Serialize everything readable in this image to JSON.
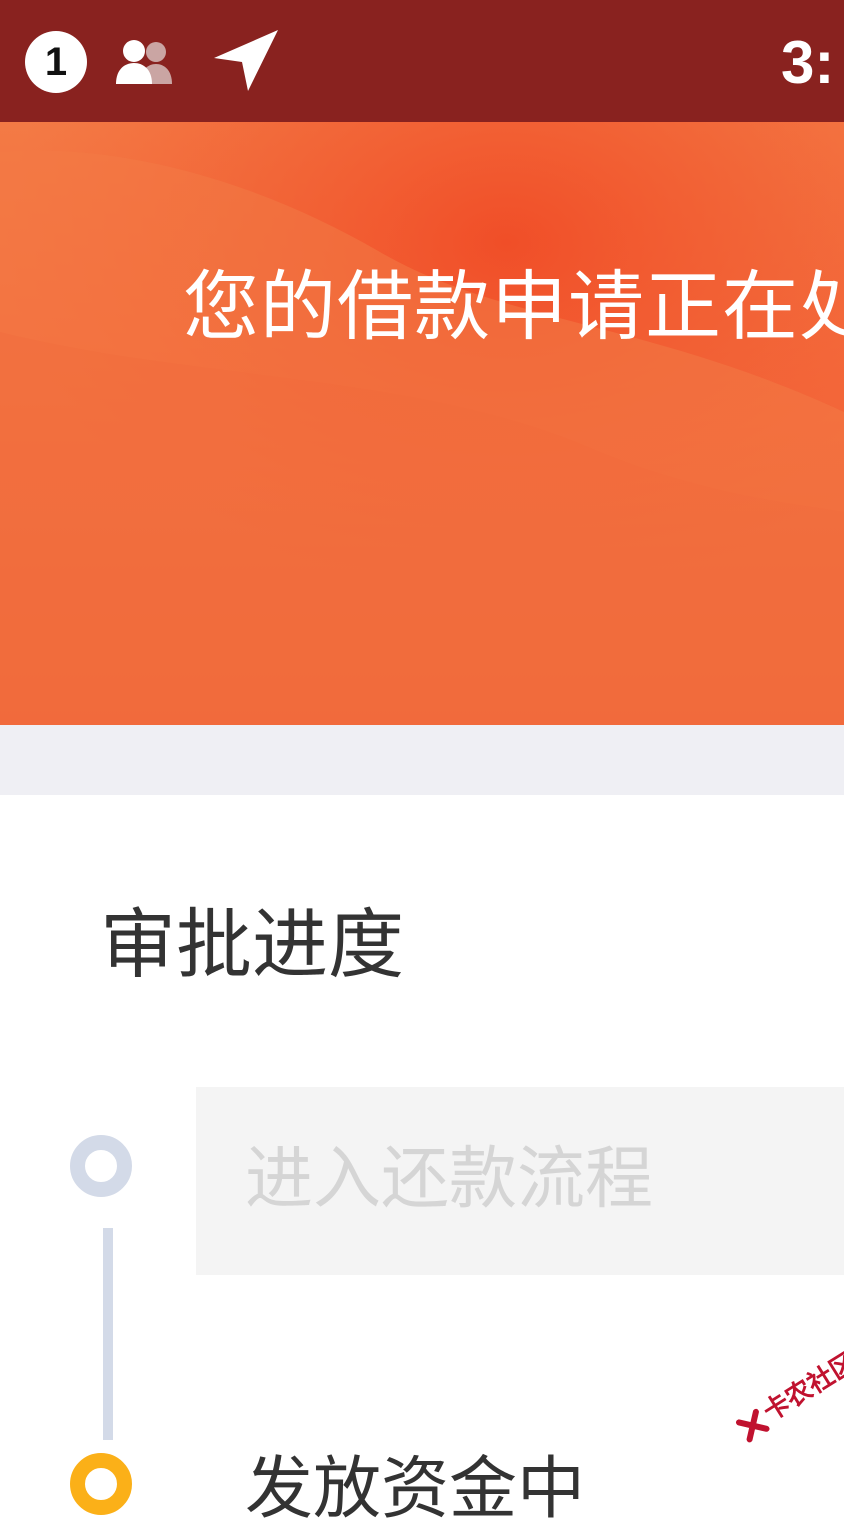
{
  "status_bar": {
    "notification_count": "1",
    "time": "3:",
    "icons": [
      "contacts-icon",
      "location-arrow-icon"
    ],
    "background": "#89221f"
  },
  "hero": {
    "title": "您的借款申请正在处",
    "gradient_colors": [
      "#f37a45",
      "#f15a31"
    ]
  },
  "approval": {
    "section_title": "审批进度",
    "steps": [
      {
        "label": "进入还款流程",
        "state": "pending"
      },
      {
        "label": "发放资金中",
        "state": "active"
      }
    ],
    "colors": {
      "pending": "#d3dae8",
      "active": "#fbb018"
    }
  },
  "watermark": {
    "text": "卡农社区",
    "color": "#c0122f"
  }
}
